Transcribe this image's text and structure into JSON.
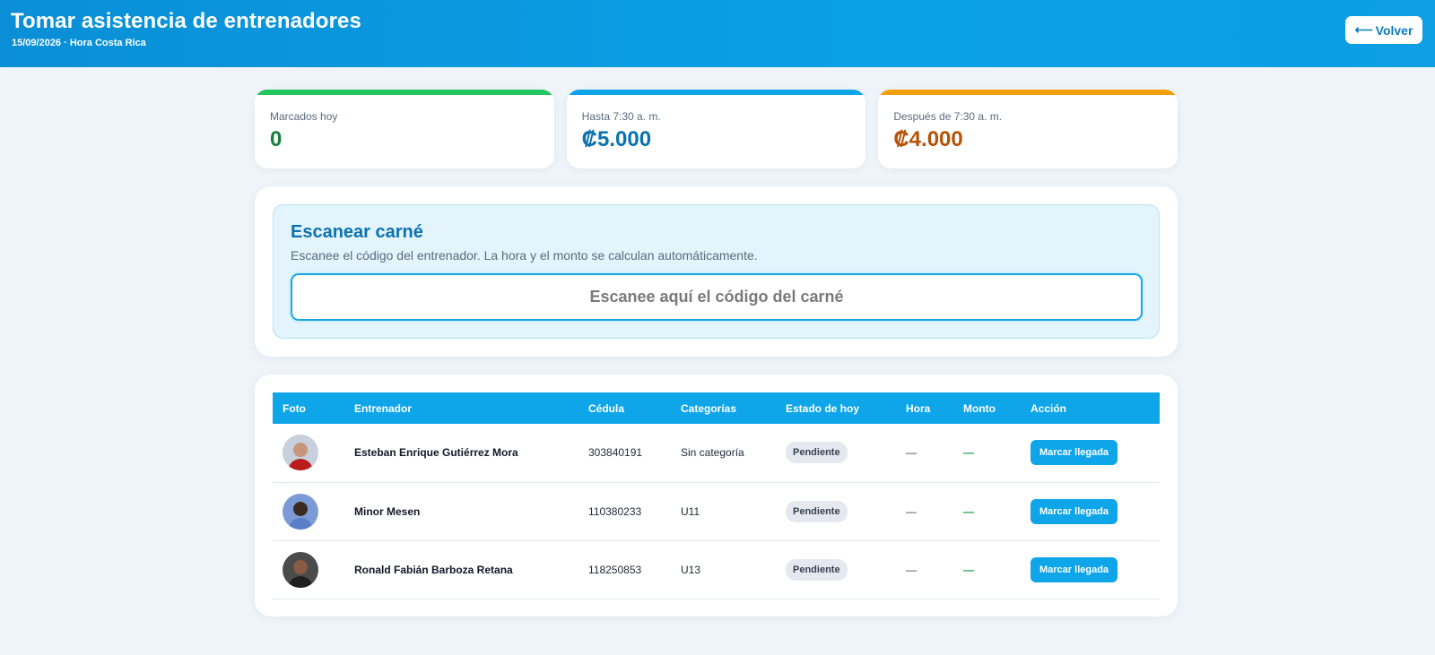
{
  "header": {
    "title": "Tomar asistencia de entrenadores",
    "subtitle": "15/09/2026 · Hora Costa Rica",
    "back_label": "Volver",
    "back_arrow": "⟵"
  },
  "stats": [
    {
      "label": "Marcados hoy",
      "value": "0",
      "accent": "#22c55e",
      "value_color": "#15803d"
    },
    {
      "label": "Hasta 7:30 a. m.",
      "value": "₡5.000",
      "accent": "#0ea5e9",
      "value_color": "#0b72b0"
    },
    {
      "label": "Después de 7:30 a. m.",
      "value": "₡4.000",
      "accent": "#f59e0b",
      "value_color": "#b45309"
    }
  ],
  "scan": {
    "title": "Escanear carné",
    "description": "Escanee el código del entrenador. La hora y el monto se calculan automáticamente.",
    "placeholder": "Escanee aquí el código del carné",
    "value": ""
  },
  "table": {
    "headers": [
      "Foto",
      "Entrenador",
      "Cédula",
      "Categorías",
      "Estado de hoy",
      "Hora",
      "Monto",
      "Acción"
    ],
    "rows": [
      {
        "name": "Esteban Enrique Gutiérrez Mora",
        "cedula": "303840191",
        "categoria": "Sin categoría",
        "estado": "Pendiente",
        "hora": "—",
        "monto": "—",
        "accion": "Marcar llegada",
        "avatar_bg": "#c7d0db",
        "shirt": "#b91c1c",
        "skin": "#c8957a"
      },
      {
        "name": "Minor Mesen",
        "cedula": "110380233",
        "categoria": "U11",
        "estado": "Pendiente",
        "hora": "—",
        "monto": "—",
        "accion": "Marcar llegada",
        "avatar_bg": "#7c9bd6",
        "shirt": "#5b7ec9",
        "skin": "#3b2a22"
      },
      {
        "name": "Ronald Fabián Barboza Retana",
        "cedula": "118250853",
        "categoria": "U13",
        "estado": "Pendiente",
        "hora": "—",
        "monto": "—",
        "accion": "Marcar llegada",
        "avatar_bg": "#4b4b4b",
        "shirt": "#1f1f1f",
        "skin": "#8a5a44"
      }
    ]
  }
}
